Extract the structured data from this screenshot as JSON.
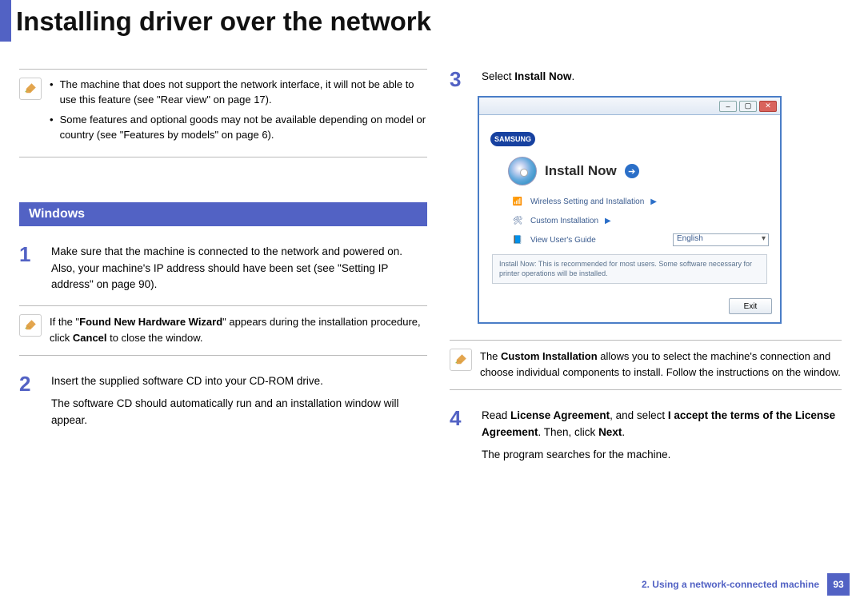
{
  "page_title": "Installing driver over the network",
  "top_note": {
    "bullets": [
      "The machine that does not support the network interface, it will not be able to use this feature (see \"Rear view\" on page 17).",
      "Some features and optional goods may not be available depending on model or country (see \"Features by models\" on page 6)."
    ]
  },
  "section_heading": "Windows",
  "steps": {
    "s1": {
      "num": "1",
      "text": "Make sure that the machine is connected to the network and powered on. Also, your machine's IP address should have been set (see \"Setting IP address\" on page 90)."
    },
    "s1_note_pre": "If the \"",
    "s1_note_b1": "Found New Hardware Wizard",
    "s1_note_mid": "\" appears during the installation procedure, click ",
    "s1_note_b2": "Cancel",
    "s1_note_post": " to close the window.",
    "s2": {
      "num": "2",
      "p1": "Insert the supplied software CD into your CD-ROM drive.",
      "p2": "The software CD should automatically run and an installation window will appear."
    },
    "s3": {
      "num": "3",
      "pre": "Select ",
      "b": "Install Now",
      "post": "."
    },
    "s3_note_pre": "The ",
    "s3_note_b": "Custom Installation",
    "s3_note_post": " allows you to select the machine's connection and choose individual components to install. Follow the instructions on the window.",
    "s4": {
      "num": "4",
      "pre": "Read ",
      "b1": "License Agreement",
      "mid1": ", and select ",
      "b2": "I accept the terms of the License Agreement",
      "mid2": ". Then, click ",
      "b3": "Next",
      "post": ".",
      "p2": "The program searches for the machine."
    }
  },
  "installer": {
    "brand": "SAMSUNG",
    "main": "Install Now",
    "row_wireless": "Wireless Setting and Installation",
    "row_custom": "Custom Installation",
    "row_guide": "View User's Guide",
    "language": "English",
    "desc": "Install Now: This is recommended for most users. Some software necessary for printer operations will be installed.",
    "exit": "Exit"
  },
  "footer": {
    "chapter": "2.  Using a network-connected machine",
    "page": "93"
  }
}
